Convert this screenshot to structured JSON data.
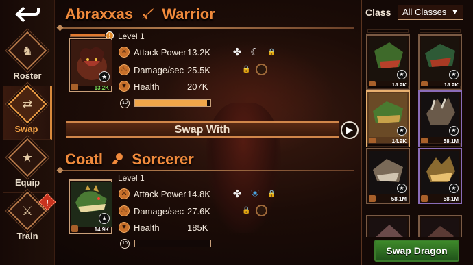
{
  "nav": {
    "items": [
      {
        "label": "Roster",
        "icon": "dragon-head-icon"
      },
      {
        "label": "Swap",
        "icon": "swap-icon",
        "active": true
      },
      {
        "label": "Equip",
        "icon": "equip-icon"
      },
      {
        "label": "Train",
        "icon": "train-icon",
        "alert": "!"
      }
    ]
  },
  "top": {
    "name": "Abraxxas",
    "role": "Warrior",
    "level": "Level 1",
    "card_power": "13.2K",
    "stats": [
      {
        "label": "Attack Power",
        "value": "13.2K"
      },
      {
        "label": "Damage/sec",
        "value": "25.5K"
      },
      {
        "label": "Health",
        "value": "207K"
      }
    ],
    "bonus_level": "10",
    "bonus_fill": 0.95,
    "xp_fill": 0.9,
    "xp_alert": "!"
  },
  "swap_with": "Swap With",
  "bottom": {
    "name": "Coatl",
    "role": "Sorcerer",
    "level": "Level 1",
    "card_power": "14.9K",
    "stats": [
      {
        "label": "Attack Power",
        "value": "14.8K"
      },
      {
        "label": "Damage/sec",
        "value": "27.6K"
      },
      {
        "label": "Health",
        "value": "185K"
      }
    ],
    "bonus_level": "10",
    "bonus_fill": 0
  },
  "panel": {
    "class_label": "Class",
    "class_select": "All Classes",
    "cards": [
      {
        "power": "14.9K",
        "colors": [
          "#3e6a2a",
          "#b8402a"
        ]
      },
      {
        "power": "14.9K",
        "colors": [
          "#2e5a36",
          "#a83a24"
        ]
      },
      {
        "power": "14.9K",
        "colors": [
          "#4a7a30",
          "#c8a24a"
        ],
        "selected": true
      },
      {
        "power": "58.1M",
        "colors": [
          "#6a5a4a",
          "#d8d0c0"
        ],
        "purple": true
      },
      {
        "power": "58.1M",
        "colors": [
          "#7a6a58",
          "#d0c4b0"
        ]
      },
      {
        "power": "58.1M",
        "colors": [
          "#8a6a30",
          "#e8c070"
        ],
        "purple": true
      }
    ],
    "swap_button": "Swap Dragon"
  }
}
